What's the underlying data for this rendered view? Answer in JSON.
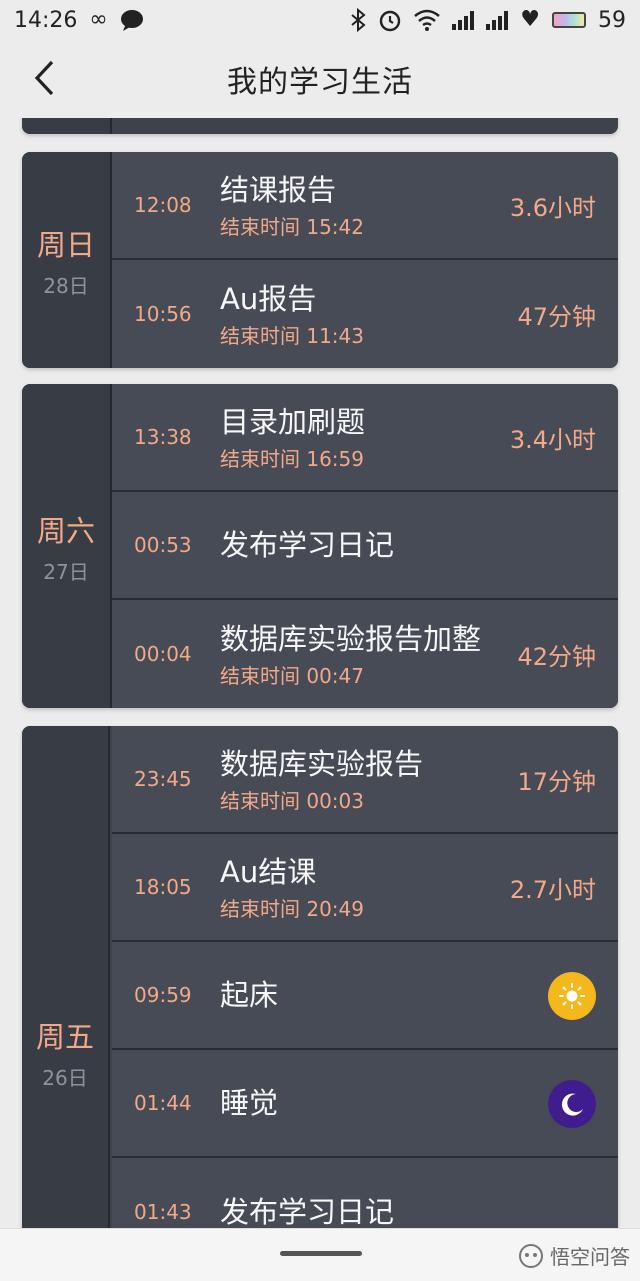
{
  "status_bar": {
    "time": "14:26",
    "battery": "59"
  },
  "header": {
    "title": "我的学习生活"
  },
  "days": [
    {
      "day": "周日",
      "date": "28日",
      "entries": [
        {
          "time": "12:08",
          "title": "结课报告",
          "end": "结束时间 15:42",
          "duration": "3.6小时"
        },
        {
          "time": "10:56",
          "title": "Au报告",
          "end": "结束时间 11:43",
          "duration": "47分钟"
        }
      ]
    },
    {
      "day": "周六",
      "date": "27日",
      "entries": [
        {
          "time": "13:38",
          "title": "目录加刷题",
          "end": "结束时间 16:59",
          "duration": "3.4小时"
        },
        {
          "time": "00:53",
          "title": "发布学习日记",
          "end": "",
          "duration": ""
        },
        {
          "time": "00:04",
          "title": "数据库实验报告加整",
          "end": "结束时间 00:47",
          "duration": "42分钟"
        }
      ]
    },
    {
      "day": "周五",
      "date": "26日",
      "entries": [
        {
          "time": "23:45",
          "title": "数据库实验报告",
          "end": "结束时间 00:03",
          "duration": "17分钟"
        },
        {
          "time": "18:05",
          "title": "Au结课",
          "end": "结束时间 20:49",
          "duration": "2.7小时"
        },
        {
          "time": "09:59",
          "title": "起床",
          "end": "",
          "duration": "",
          "icon": "sun-icon"
        },
        {
          "time": "01:44",
          "title": "睡觉",
          "end": "",
          "duration": "",
          "icon": "moon-icon"
        },
        {
          "time": "01:43",
          "title": "发布学习日记",
          "end": "",
          "duration": ""
        }
      ]
    }
  ],
  "bottom": {
    "watermark": "悟空问答"
  },
  "colors": {
    "accent": "#f2a989",
    "card": "#464b55",
    "day_col": "#383c44",
    "sun": "#f5b81c",
    "moon": "#3f1d8f"
  }
}
